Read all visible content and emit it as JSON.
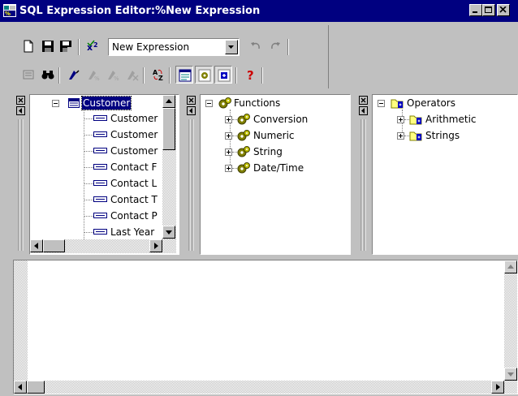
{
  "window": {
    "title": "SQL Expression Editor:%New Expression"
  },
  "toolbar": {
    "expression_combo_value": "New Expression"
  },
  "fields_tree": {
    "root": "Customer",
    "items": [
      "Customer",
      "Customer",
      "Customer",
      "Contact F",
      "Contact L",
      "Contact T",
      "Contact P",
      "Last Year"
    ]
  },
  "functions_tree": {
    "root": "Functions",
    "items": [
      "Conversion",
      "Numeric",
      "String",
      "Date/Time"
    ]
  },
  "operators_tree": {
    "root": "Operators",
    "items": [
      "Arithmetic",
      "Strings"
    ]
  },
  "colors": {
    "titlebar": "#000080",
    "face": "#c0c0c0",
    "help_icon": "#cc0000"
  }
}
